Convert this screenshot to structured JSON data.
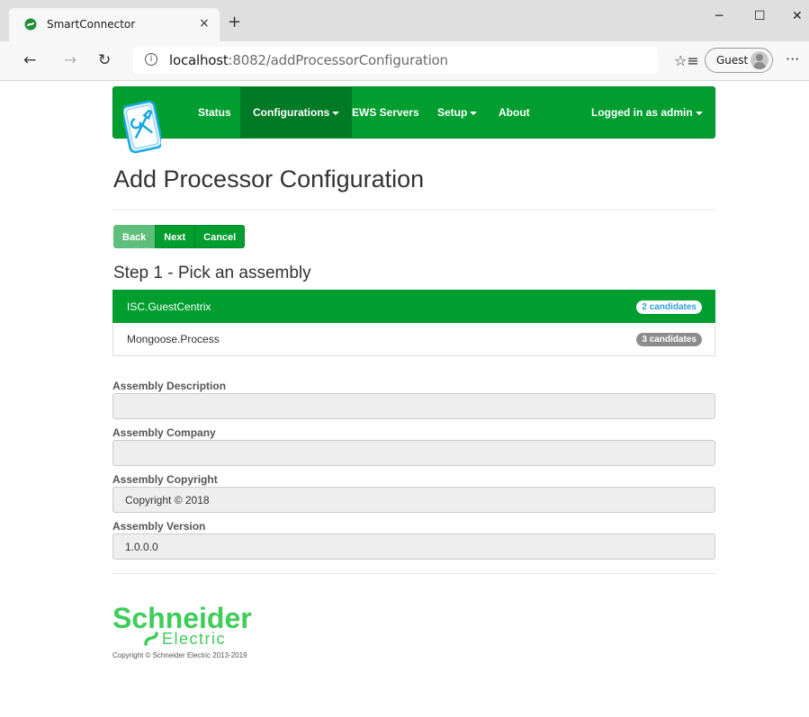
{
  "browser": {
    "tab_title": "SmartConnector",
    "tab_close": "×",
    "new_tab": "+",
    "window_controls": {
      "minimize": "─",
      "maximize": "☐",
      "close": "✕"
    },
    "back": "←",
    "forward": "→",
    "refresh": "↻",
    "address_host": "localhost",
    "address_path": ":8082/addProcessorConfiguration",
    "info_icon": "i",
    "favorites_icon": "☆≡",
    "profile_label": "Guest",
    "more_icon": "···",
    "favicon_color": "#1f8f3a"
  },
  "navbar": {
    "brand_color": "#009e2f",
    "items": [
      {
        "label": "Status",
        "active": false,
        "dropdown": false
      },
      {
        "label": "Configurations",
        "active": true,
        "dropdown": true
      },
      {
        "label": "EWS Servers",
        "active": false,
        "dropdown": false
      },
      {
        "label": "Setup",
        "active": false,
        "dropdown": true
      },
      {
        "label": "About",
        "active": false,
        "dropdown": false
      }
    ],
    "user_menu": "Logged in as admin"
  },
  "page": {
    "title": "Add Processor Configuration",
    "buttons": {
      "back": "Back",
      "next": "Next",
      "cancel": "Cancel"
    },
    "step_title": "Step 1 - Pick an assembly",
    "assemblies": [
      {
        "name": "ISC.GuestCentrix",
        "candidates": "2 candidates",
        "selected": true
      },
      {
        "name": "Mongoose.Process",
        "candidates": "3 candidates",
        "selected": false
      }
    ],
    "fields": [
      {
        "label": "Assembly Description",
        "value": ""
      },
      {
        "label": "Assembly Company",
        "value": ""
      },
      {
        "label": "Assembly Copyright",
        "value": "Copyright ©  2018"
      },
      {
        "label": "Assembly Version",
        "value": "1.0.0.0"
      }
    ]
  },
  "footer": {
    "logo_line1": "Schneider",
    "logo_line2": "Electric",
    "copyright": "Copyright © Schneider Electric 2013-2019"
  }
}
